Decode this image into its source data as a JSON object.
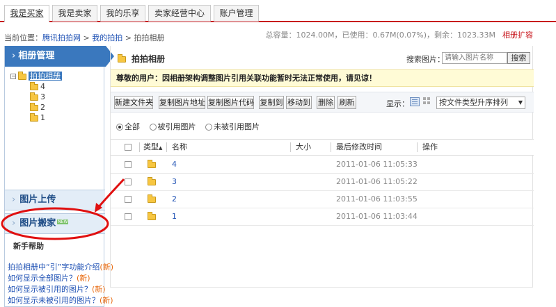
{
  "topnav": {
    "tabs": [
      {
        "label": "我是买家",
        "active": true
      },
      {
        "label": "我是卖家",
        "active": false
      },
      {
        "label": "我的乐享",
        "active": false
      },
      {
        "label": "卖家经营中心",
        "active": false
      },
      {
        "label": "账户管理",
        "active": false
      }
    ],
    "accent": "#c8161d"
  },
  "location": {
    "prefix": "当前位置：",
    "crumbs": [
      "腾讯拍拍网",
      "我的拍拍",
      "拍拍相册"
    ],
    "sep": ">",
    "capacity": "总容量：1024.00M，已使用：0.67M(0.07%)，剩余：1023.33M",
    "expand": "相册扩容"
  },
  "sidebar": {
    "header": "相册管理",
    "tree": {
      "root": "拍拍相册",
      "children": [
        "4",
        "3",
        "2",
        "1"
      ]
    },
    "upload": "图片上传",
    "move": "图片搬家",
    "help_title": "新手帮助",
    "help_links": [
      {
        "text": "拍拍相册中“引”字功能介绍",
        "new": "(新)"
      },
      {
        "text": "如何显示全部图片？",
        "new": "(新)"
      },
      {
        "text": "如何显示被引用的图片？",
        "new": "(新)"
      },
      {
        "text": "如何显示未被引用的图片？",
        "new": "(新)"
      }
    ]
  },
  "main": {
    "title": "拍拍相册",
    "search_label": "搜索图片：",
    "search_placeholder": "请输入图片名称",
    "search_button": "搜索",
    "notice": "尊敬的用户：因相册架构调整图片引用关联功能暂时无法正常使用，请见谅！",
    "toolbar": {
      "buttons": [
        "新建文件夹",
        "复制图片地址",
        "复制图片代码",
        "复制到",
        "移动到",
        "删除",
        "刷新"
      ],
      "view_label": "显示：",
      "sort": "按文件类型升序排列"
    },
    "filters": [
      "全部",
      "被引用图片",
      "未被引用图片"
    ],
    "columns": [
      "类型",
      "名称",
      "大小",
      "最后修改时间",
      "操作"
    ],
    "sort_indicator": "▲",
    "rows": [
      {
        "name": "4",
        "size": "",
        "modified": "2011-01-06 11:05:33"
      },
      {
        "name": "3",
        "size": "",
        "modified": "2011-01-06 11:05:22"
      },
      {
        "name": "2",
        "size": "",
        "modified": "2011-01-06 11:03:55"
      },
      {
        "name": "1",
        "size": "",
        "modified": "2011-01-06 11:03:44"
      }
    ]
  },
  "icons": {
    "folder": "folder-icon",
    "tree_toggle": "minus-icon",
    "chevron": "chevron-right-icon",
    "view_list": "list-view-icon",
    "view_grid": "grid-view-icon"
  },
  "colors": {
    "sidebar_header": "#3a78be",
    "notice_bg": "#fffbd6",
    "annotation": "#e01010",
    "link": "#1c4fb3"
  }
}
